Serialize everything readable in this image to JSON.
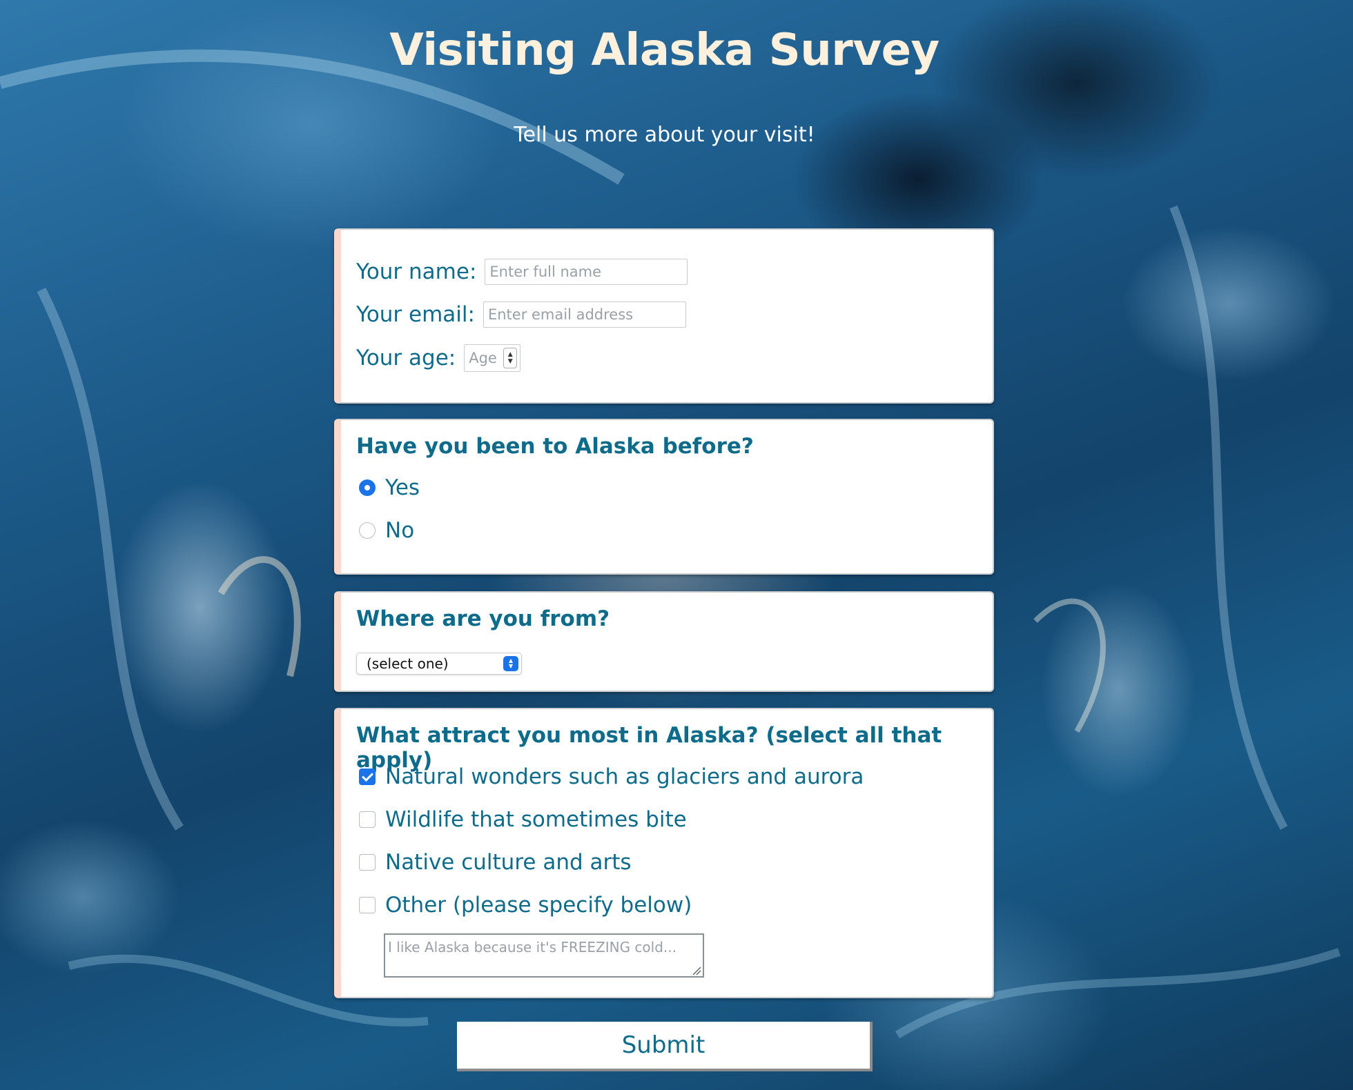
{
  "page": {
    "title": "Visiting Alaska Survey",
    "subtitle": "Tell us more about your visit!"
  },
  "personal": {
    "name_label": "Your name:",
    "name_placeholder": "Enter full name",
    "name_value": "",
    "email_label": "Your email:",
    "email_placeholder": "Enter email address",
    "email_value": "",
    "age_label": "Your age:",
    "age_placeholder": "Age",
    "age_value": ""
  },
  "visited": {
    "question": "Have you been to Alaska before?",
    "options": [
      {
        "label": "Yes",
        "checked": true
      },
      {
        "label": "No",
        "checked": false
      }
    ]
  },
  "origin": {
    "question": "Where are you from?",
    "selected": "(select one)"
  },
  "attractions": {
    "question": "What attract you most in Alaska? (select all that apply)",
    "options": [
      {
        "label": "Natural wonders such as glaciers and aurora",
        "checked": true
      },
      {
        "label": "Wildlife that sometimes bite",
        "checked": false
      },
      {
        "label": "Native culture and arts",
        "checked": false
      },
      {
        "label": "Other (please specify below)",
        "checked": false
      }
    ],
    "other_placeholder": "I like Alaska because it's FREEZING cold...",
    "other_value": ""
  },
  "submit_label": "Submit",
  "colors": {
    "title": "#fdf0dc",
    "label": "#0f6b8a",
    "card_accent": "#f9d9cc",
    "control_accent": "#1a73e8",
    "background": "#1c5a89"
  },
  "icons": {
    "radio_checked": "radio-checked-icon",
    "checkbox_checked": "checkmark-icon",
    "select_arrows": "select-arrows-icon",
    "spinner": "spinner-arrows-icon"
  }
}
